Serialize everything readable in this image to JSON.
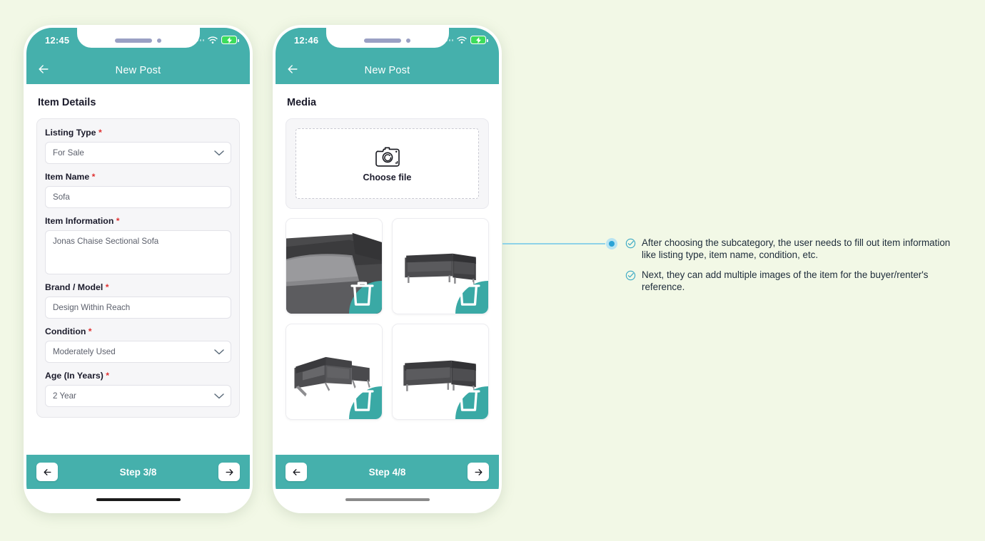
{
  "theme": {
    "teal": "#45b0ac",
    "teal_dark": "#3aa9a5",
    "background": "#f2f8e6",
    "required_red": "#e03131",
    "connector_blue": "#8ed2e8",
    "dot_blue": "#2aa3d6"
  },
  "phone1": {
    "status": {
      "time": "12:45",
      "wifi_icon": "wifi-icon",
      "battery_icon": "battery-charging-icon",
      "signal_icon": "signal-dots-icon"
    },
    "appbar": {
      "title": "New Post",
      "back_icon": "arrow-left-icon"
    },
    "section_title": "Item Details",
    "fields": [
      {
        "label": "Listing Type",
        "required": "*",
        "value": "For Sale",
        "type": "select",
        "icon": "chevron-down-icon"
      },
      {
        "label": "Item Name",
        "required": "*",
        "value": "Sofa",
        "type": "text"
      },
      {
        "label": "Item Information",
        "required": "*",
        "value": "Jonas Chaise Sectional Sofa",
        "type": "textarea"
      },
      {
        "label": "Brand / Model",
        "required": "*",
        "value": "Design Within Reach",
        "type": "text"
      },
      {
        "label": "Condition",
        "required": "*",
        "value": "Moderately Used",
        "type": "select",
        "icon": "chevron-down-icon"
      },
      {
        "label": "Age (In Years)",
        "required": "*",
        "value": "2 Year",
        "type": "select",
        "icon": "chevron-down-icon"
      }
    ],
    "footer": {
      "step": "Step 3/8",
      "back_icon": "arrow-left-icon",
      "next_icon": "arrow-right-icon"
    },
    "home_indicator_color": "#1a1a1a"
  },
  "phone2": {
    "status": {
      "time": "12:46",
      "wifi_icon": "wifi-icon",
      "battery_icon": "battery-charging-icon",
      "signal_icon": "signal-dots-icon"
    },
    "appbar": {
      "title": "New Post",
      "back_icon": "arrow-left-icon"
    },
    "section_title": "Media",
    "dropzone": {
      "label": "Choose file",
      "icon": "camera-icon"
    },
    "thumbnails": [
      {
        "name": "sofa-closeup-gray",
        "delete_icon": "trash-icon"
      },
      {
        "name": "sofa-sectional-front",
        "delete_icon": "trash-icon"
      },
      {
        "name": "sofa-sectional-angle",
        "delete_icon": "trash-icon"
      },
      {
        "name": "sofa-sectional-side",
        "delete_icon": "trash-icon"
      }
    ],
    "footer": {
      "step": "Step 4/8",
      "back_icon": "arrow-left-icon",
      "next_icon": "arrow-right-icon"
    },
    "home_indicator_color": "#8a8a8a"
  },
  "annotation": {
    "marker_icon": "connector-dot",
    "notes": [
      {
        "icon": "check-circle-icon",
        "text": "After choosing the subcategory, the user needs to fill out item information like listing type, item name, condition, etc."
      },
      {
        "icon": "check-circle-icon",
        "text": "Next, they can add multiple images of the item for the buyer/renter's reference."
      }
    ]
  }
}
